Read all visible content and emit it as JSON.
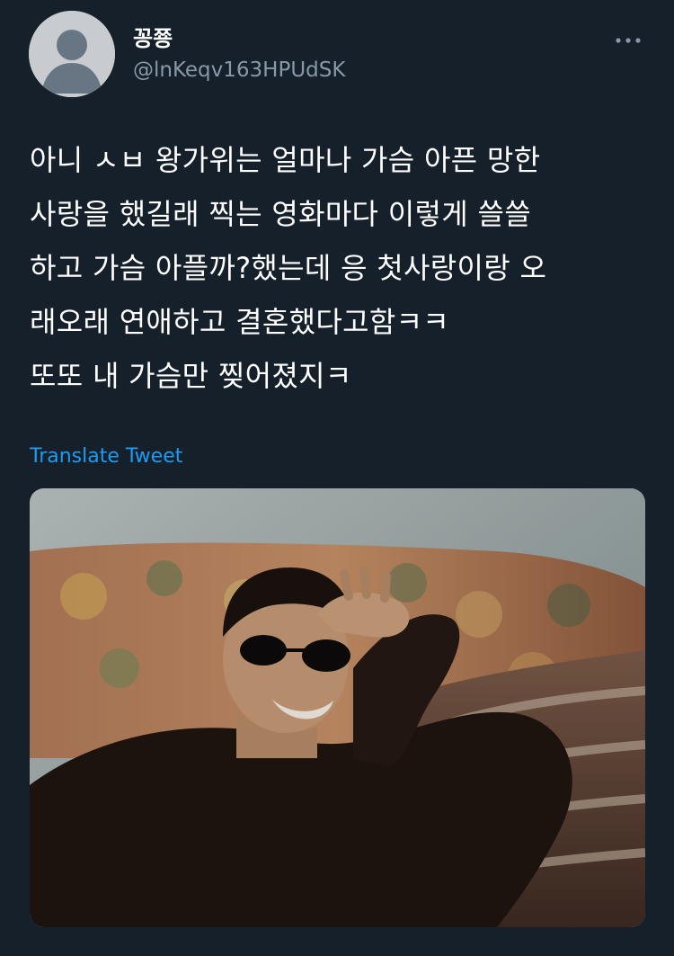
{
  "tweet": {
    "display_name": "꽁쭁",
    "handle": "@lnKeqv163HPUdSK",
    "text_lines": [
      "아니 ㅅㅂ 왕가위는 얼마나 가슴 아픈 망한",
      "사랑을 했길래 찍는 영화마다 이렇게 쓸쓸",
      "하고 가슴 아플까?했는데 응 첫사랑이랑 오",
      "래오래 연애하고 결혼했다고함ㅋㅋ",
      "또또 내 가슴만 찢어졌지ㅋ"
    ],
    "translate_label": "Translate Tweet"
  },
  "icons": {
    "avatar": "default-avatar-icon",
    "more": "more-options-icon"
  },
  "colors": {
    "background": "#15202b",
    "secondary_text": "#8899a6",
    "link": "#1d9bf0"
  }
}
